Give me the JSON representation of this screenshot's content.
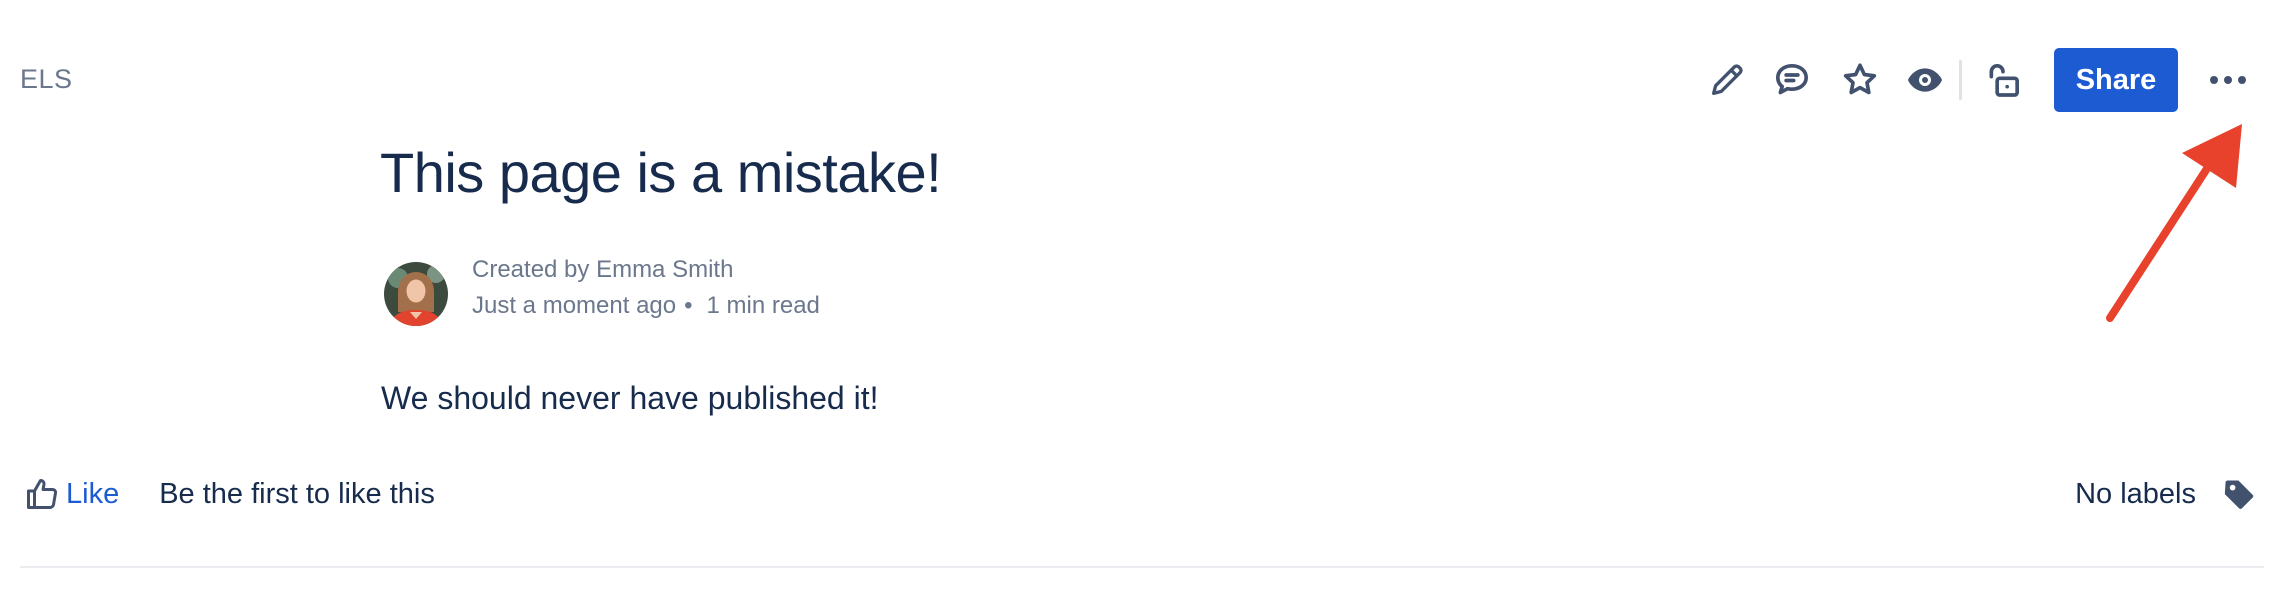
{
  "header": {
    "space_key": "ELS",
    "share_label": "Share"
  },
  "toolbar_icons": [
    "edit-icon",
    "comment-icon",
    "star-icon",
    "watch-icon",
    "unlock-icon",
    "more-icon"
  ],
  "page": {
    "title": "This page is a mistake!",
    "author_line": "Created by Emma Smith",
    "time": "Just a moment ago",
    "separator": "•",
    "read_time": "1 min read",
    "body": "We should never have published it!"
  },
  "footer": {
    "like_label": "Like",
    "like_hint": "Be the first to like this",
    "labels_text": "No labels"
  },
  "colors": {
    "primary": "#1d5bd3",
    "text": "#172b4d",
    "subtle": "#6b778c",
    "icon": "#42526e",
    "annotation": "#e8412c"
  }
}
